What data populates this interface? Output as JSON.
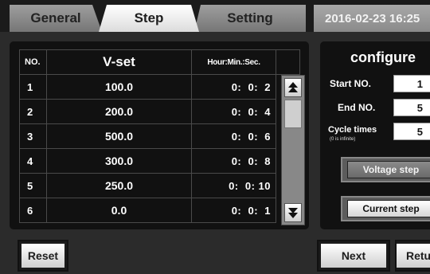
{
  "tabs": [
    "General",
    "Step",
    "Setting"
  ],
  "datetime": "2016-02-23 16:25",
  "table": {
    "headers": {
      "no": "NO.",
      "vset": "V-set",
      "time": "Hour:Min.:Sec."
    },
    "rows": [
      {
        "no": "1",
        "vset": "100.0",
        "time": "0:  0:  2"
      },
      {
        "no": "2",
        "vset": "200.0",
        "time": "0:  0:  4"
      },
      {
        "no": "3",
        "vset": "500.0",
        "time": "0:  0:  6"
      },
      {
        "no": "4",
        "vset": "300.0",
        "time": "0:  0:  8"
      },
      {
        "no": "5",
        "vset": "250.0",
        "time": "0:  0: 10"
      },
      {
        "no": "6",
        "vset": "0.0",
        "time": "0:  0:  1"
      }
    ],
    "scroll_up_icon": "scroll-up-arrow",
    "scroll_down_icon": "scroll-down-arrow"
  },
  "configure": {
    "title": "configure",
    "start_no_label": "Start NO.",
    "start_no_value": "1",
    "end_no_label": "End NO.",
    "end_no_value": "5",
    "cycle_label": "Cycle times",
    "cycle_sub": "(0 is infinite)",
    "cycle_value": "5",
    "voltage_step_label": "Voltage step",
    "current_step_label": "Current step"
  },
  "buttons": {
    "reset": "Reset",
    "next": "Next",
    "return": "Return"
  }
}
